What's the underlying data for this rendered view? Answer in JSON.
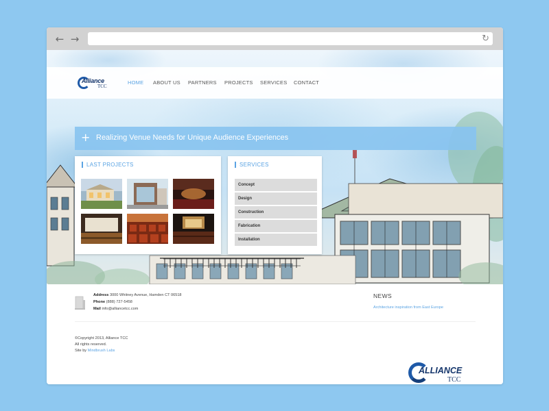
{
  "browser": {
    "back_icon": "arrow-left-icon",
    "forward_icon": "arrow-right-icon",
    "reload_icon": "reload-icon",
    "back_glyph": "←",
    "forward_glyph": "→",
    "reload_glyph": "↻",
    "url": ""
  },
  "header": {
    "logo_main": "Alliance",
    "logo_sub": "TCC",
    "nav": [
      {
        "label": "HOME",
        "active": true
      },
      {
        "label": "ABOUT US",
        "active": false
      },
      {
        "label": "PARTNERS",
        "active": false
      },
      {
        "label": "PROJECTS",
        "active": false
      },
      {
        "label": "SERVICES",
        "active": false
      },
      {
        "label": "CONTACT",
        "active": false
      }
    ]
  },
  "banner": {
    "plus_glyph": "+",
    "text": "Realizing Venue Needs for Unique Audience Experiences"
  },
  "last_projects": {
    "title": "LAST PROJECTS",
    "thumbnails": [
      "project-exterior-dusk",
      "project-building-facade",
      "project-theater-interior",
      "project-cinema-hall",
      "project-red-seats",
      "project-auditorium-stage"
    ]
  },
  "services": {
    "title": "SERVICES",
    "items": [
      "Concept",
      "Design",
      "Construction",
      "Fabrication",
      "Installation"
    ]
  },
  "footer": {
    "address_label": "Address",
    "address_value": "3000 Whitney Avenue, Hamden CT 06518",
    "phone_label": "Phone",
    "phone_value": "(888) 727-5458",
    "mail_label": "Mail",
    "mail_value": "info@alliancetcc.com",
    "news_title": "NEWS",
    "news_item": "Architecture inspiration from East Europe",
    "copyright": "©Copyright 2013, Alliance TCC",
    "rights": "All rights reserved.",
    "site_by_label": "Site by",
    "site_by_link": "Mindbrush Labs",
    "logo_main": "ALLIANCE",
    "logo_sub": "TCC"
  },
  "colors": {
    "page_background": "#8ec8f0",
    "accent": "#5aa3e3",
    "banner": "#87c3f0",
    "logo_blue": "#14356b",
    "service_item": "#dcdcdc"
  }
}
